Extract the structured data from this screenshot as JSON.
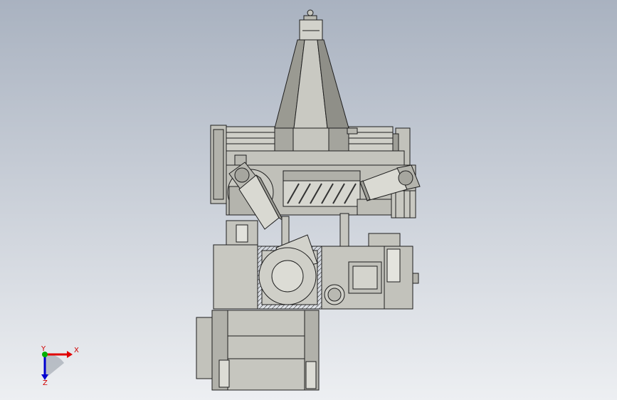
{
  "viewport": {
    "background_top": "#a9b2c0",
    "background_bottom": "#edeff2",
    "model_color": "#c6c6bf",
    "model_shadow": "#8e8e87",
    "edge_color": "#1e1e1e"
  },
  "triad": {
    "x_label": "X",
    "y_label": "Y",
    "z_label": "Z",
    "x_color": "#e00000",
    "y_color": "#00b000",
    "z_color": "#0000d0",
    "label_color": "#d00000"
  }
}
